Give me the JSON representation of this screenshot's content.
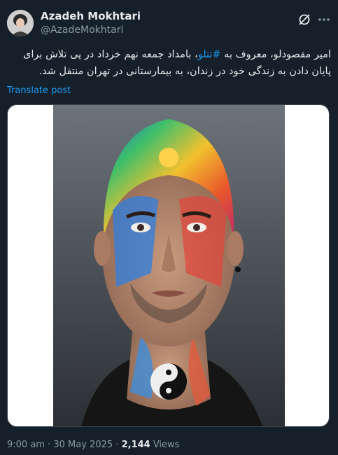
{
  "author": {
    "name": "Azadeh Mokhtari",
    "handle": "@AzadeMokhtari"
  },
  "icons": {
    "grok": "grok-icon",
    "more": "more-icon"
  },
  "tweet": {
    "text_part1": "امیر مقصودلو، معروف به ",
    "hashtag": "#تتلو",
    "text_part2": "، بامداد جمعه نهم خرداد در پی تلاش برای پایان دادن به زندگی خود در زندان، به بیمارستانی در تهران منتقل شد.",
    "translate_label": "Translate post"
  },
  "meta": {
    "time": "9:00 am",
    "sep1": " · ",
    "date": "30 May 2025",
    "sep2": " · ",
    "views_count": "2,144",
    "views_label": " Views"
  },
  "colors": {
    "background": "#15202b",
    "link": "#1d9bf0",
    "secondary_text": "#8b98a5"
  }
}
